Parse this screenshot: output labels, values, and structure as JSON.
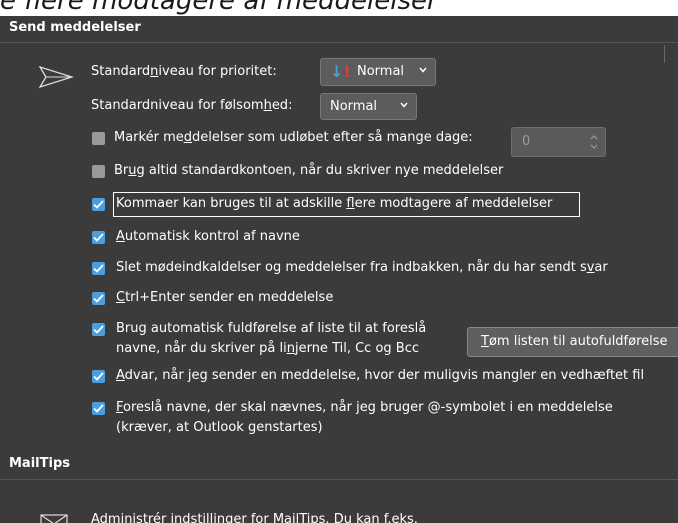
{
  "caption": {
    "text": "e flere modtagere af meddelelser"
  },
  "send": {
    "heading": "Send meddelelser",
    "priority": {
      "label_pre": "Standard",
      "label_key": "n",
      "label_post": "iveau for prioritet:",
      "value": "Normal"
    },
    "sensitivity": {
      "label_pre": "Standardniveau for følsom",
      "label_key": "h",
      "label_post": "ed:",
      "value": "Normal"
    },
    "expire": {
      "label_pre": "Markér me",
      "label_key": "d",
      "label_post": "delelser som udløbet efter så mange dage:",
      "days": "0",
      "checked": false
    },
    "default_account": {
      "label_pre": "Br",
      "label_key": "u",
      "label_post": "g altid standardkontoen, når du skriver nye meddelelser",
      "checked": false
    },
    "commas": {
      "label": "Kommaer kan bruges til at adskille ",
      "label_key": "f",
      "label_post": "lere modtagere af meddelelser",
      "checked": true
    },
    "autoname": {
      "label_key": "A",
      "label_post": "utomatisk kontrol af navne",
      "checked": true
    },
    "delete_meeting": {
      "label_pre": "Slet mødeindkaldelser og meddelelser fra indbakken, når du har sendt s",
      "label_key": "v",
      "label_post": "ar",
      "checked": true
    },
    "ctrl_enter": {
      "label_key": "C",
      "label_post": "trl+Enter sender en meddelelse",
      "checked": true
    },
    "autocomplete": {
      "line1": "Brug automatisk fuldførelse af liste til at foreslå",
      "line2_pre": "navne, når du skriver på li",
      "line2_key": "n",
      "line2_post": "jerne Til, Cc og Bcc",
      "checked": true,
      "button_key": "T",
      "button_post": "øm listen til autofuldførelse"
    },
    "warn_attachment": {
      "label_key": "A",
      "label_post": "dvar, når jeg sender en meddelelse, hvor der muligvis mangler en vedhæftet fil",
      "checked": true
    },
    "suggest_names": {
      "line1_key": "F",
      "line1_post": "oreslå navne, der skal nævnes, når jeg bruger @-symbolet i en meddelelse",
      "line2": "(kræver, at Outlook genstartes)",
      "checked": true
    }
  },
  "mailtips": {
    "heading": "MailTips",
    "description": "Administrér indstillinger for MailTips. Du kan f.eks."
  },
  "colors": {
    "panel": "#3b3b3b",
    "checkbox_on": "#4c9ede",
    "priority_arrow": "#4c9ede",
    "priority_bang": "#e03c3c"
  },
  "icons": [
    "send-icon",
    "priority-icon",
    "chevron-down-icon",
    "checkmark-icon",
    "spinner-icon",
    "mail-icon"
  ]
}
